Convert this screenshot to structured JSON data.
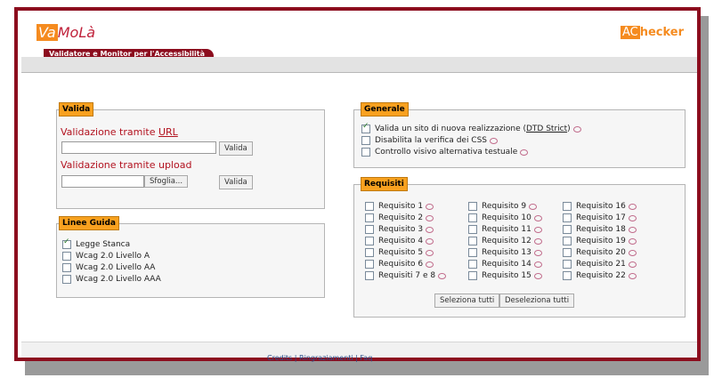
{
  "header": {
    "logo_va": "Va",
    "logo_rest": "MoLà",
    "tagline": "Validatore e Monitor per l'Accessibilità",
    "achecker_ac": "AC",
    "achecker_rest": "hecker"
  },
  "valida": {
    "legend": "Valida",
    "url_heading_prefix": "Validazione tramite ",
    "url_heading_link": "URL",
    "url_value": "",
    "valida_button": "Valida",
    "upload_heading": "Validazione tramite upload",
    "browse_button": "Sfoglia...",
    "file_value": ""
  },
  "linee_guida": {
    "legend": "Linee Guida",
    "items": [
      {
        "label": "Legge Stanca",
        "checked": true
      },
      {
        "label": "Wcag 2.0 Livello A",
        "checked": false
      },
      {
        "label": "Wcag 2.0 Livello AA",
        "checked": false
      },
      {
        "label": "Wcag 2.0 Livello AAA",
        "checked": false
      }
    ]
  },
  "generale": {
    "legend": "Generale",
    "item1_prefix": "Valida un sito di nuova realizzazione (",
    "item1_link": "DTD Strict",
    "item1_suffix": ")",
    "item2": "Disabilita la verifica dei CSS",
    "item3": "Controllo visivo alternativa testuale"
  },
  "requisiti": {
    "legend": "Requisiti",
    "col1": [
      "Requisito 1",
      "Requisito 2",
      "Requisito 3",
      "Requisito 4",
      "Requisito 5",
      "Requisito 6",
      "Requisiti 7 e 8"
    ],
    "col2": [
      "Requisito 9",
      "Requisito 10",
      "Requisito 11",
      "Requisito 12",
      "Requisito 13",
      "Requisito 14",
      "Requisito 15"
    ],
    "col3": [
      "Requisito 16",
      "Requisito 17",
      "Requisito 18",
      "Requisito 19",
      "Requisito 20",
      "Requisito 21",
      "Requisito 22"
    ],
    "select_all": "Seleziona tutti",
    "deselect_all": "Deseleziona tutti"
  },
  "footer": {
    "credits": "Credits",
    "sep": "|",
    "thanks": "Ringraziamenti",
    "faq": "Faq"
  }
}
